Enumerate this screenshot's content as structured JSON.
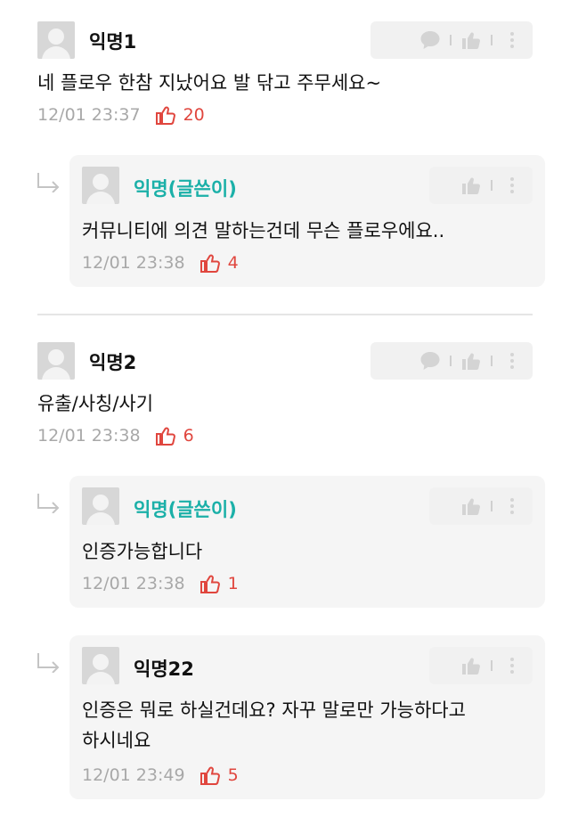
{
  "comments": [
    {
      "author": "익명1",
      "text": "네 플로우 한참 지났어요 발 닦고 주무세요~",
      "time": "12/01 23:37",
      "likes": "20",
      "replies": [
        {
          "author": "익명(글쓴이)",
          "text": "커뮤니티에 의견 말하는건데 무슨 플로우에요..",
          "time": "12/01 23:38",
          "likes": "4"
        }
      ]
    },
    {
      "author": "익명2",
      "text": "유출/사칭/사기",
      "time": "12/01 23:38",
      "likes": "6",
      "replies": [
        {
          "author": "익명(글쓴이)",
          "text": "인증가능합니다",
          "time": "12/01 23:38",
          "likes": "1"
        },
        {
          "author": "익명22",
          "text_lines": [
            "인증은 뭐로 하실건데요? 자꾸 말로만 가능하다고",
            "하시네요"
          ],
          "time": "12/01 23:49",
          "likes": "5"
        }
      ]
    }
  ],
  "icons": {
    "reply": "speech-bubble-icon",
    "like": "thumbs-up-icon",
    "more": "kebab-more-icon",
    "reply_indicator": "reply-arrow-icon"
  },
  "colors": {
    "op_author": "#1bb0a8",
    "like_count": "#e0463e",
    "meta_text": "#a8a8a8",
    "action_bg": "#f1f1f1",
    "reply_bg": "#f5f5f5"
  }
}
